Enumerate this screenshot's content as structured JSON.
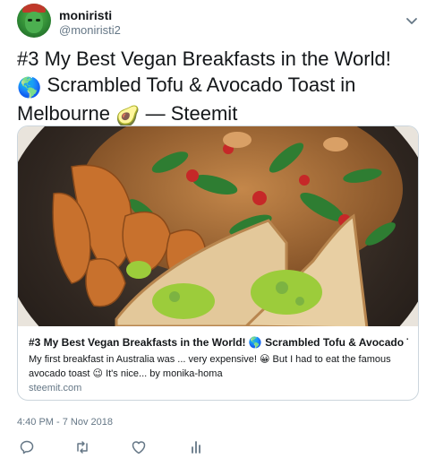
{
  "user": {
    "name": "moniristi",
    "handle": "@moniristi2"
  },
  "tweet": {
    "text_line1": "#3 My Best Vegan Breakfasts in the World!",
    "text_line2": "Scrambled Tofu & Avocado Toast in",
    "text_line3_a": "Melbourne",
    "text_line3_b": "— Steemit",
    "emoji_globe": "🌎",
    "emoji_avocado": "🥑",
    "timestamp": "4:40 PM - 7 Nov 2018"
  },
  "card": {
    "title": "#3 My Best Vegan Breakfasts in the World! 🌎 Scrambled Tofu & Avocado T...",
    "description_line1": "My first breakfast in Australia was ... very expensive! 😀 But I had to eat the famous",
    "description_line2": "avocado toast 😉 It's nice... by monika-homa",
    "domain": "steemit.com"
  },
  "icons": {
    "menu": "chevron-down-icon",
    "reply": "reply-icon",
    "retweet": "retweet-icon",
    "like": "heart-icon",
    "analytics": "analytics-icon"
  },
  "colors": {
    "text": "#14171a",
    "muted": "#657786",
    "border": "#ccd6dd"
  }
}
